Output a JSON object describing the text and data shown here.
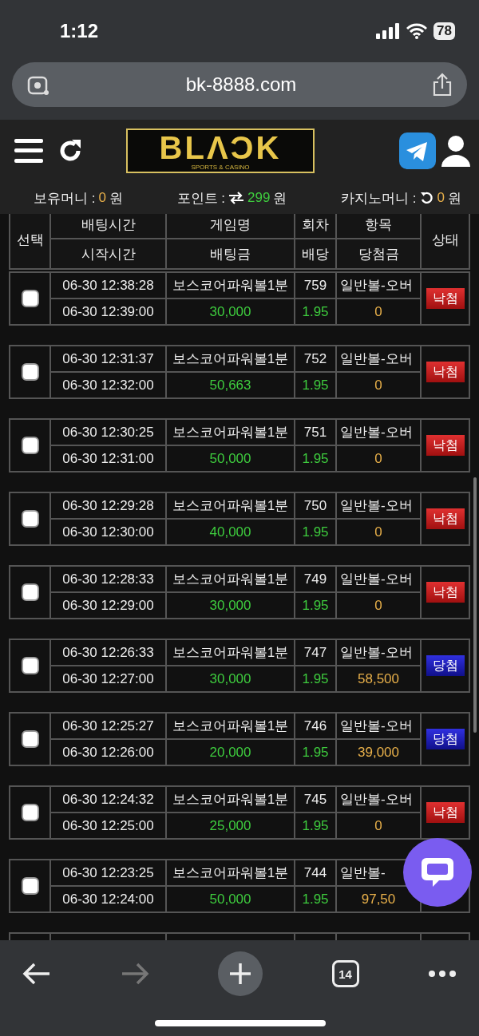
{
  "status_bar": {
    "time": "1:12",
    "battery": "78"
  },
  "browser": {
    "url": "bk-8888.com"
  },
  "header": {
    "logo": "BLΛƆK",
    "logo_tagline": "SPORTS & CASINO"
  },
  "balances": [
    {
      "label": "보유머니 :",
      "value": "0",
      "unit": "원",
      "kind": "plain"
    },
    {
      "label": "포인트 :",
      "value": "299",
      "unit": "원",
      "kind": "point"
    },
    {
      "label": "카지노머니 :",
      "value": "0",
      "unit": "원",
      "kind": "casino"
    }
  ],
  "table": {
    "columns_top": [
      "선택",
      "배팅시간",
      "게임명",
      "회차",
      "항목",
      "상태"
    ],
    "columns_bottom": [
      "시작시간",
      "배팅금",
      "배당",
      "당첨금"
    ],
    "rows": [
      {
        "checked": false,
        "bet_time": "06-30 12:38:28",
        "game": "보스코어파워볼1분",
        "round": "759",
        "item": "일반볼-오버",
        "start_time": "06-30 12:39:00",
        "amount": "30,000",
        "odds": "1.95",
        "winnings": "0",
        "status": {
          "label": "낙첨",
          "kind": "lose"
        }
      },
      {
        "checked": false,
        "bet_time": "06-30 12:31:37",
        "game": "보스코어파워볼1분",
        "round": "752",
        "item": "일반볼-오버",
        "start_time": "06-30 12:32:00",
        "amount": "50,663",
        "odds": "1.95",
        "winnings": "0",
        "status": {
          "label": "낙첨",
          "kind": "lose"
        }
      },
      {
        "checked": false,
        "bet_time": "06-30 12:30:25",
        "game": "보스코어파워볼1분",
        "round": "751",
        "item": "일반볼-오버",
        "start_time": "06-30 12:31:00",
        "amount": "50,000",
        "odds": "1.95",
        "winnings": "0",
        "status": {
          "label": "낙첨",
          "kind": "lose"
        }
      },
      {
        "checked": false,
        "bet_time": "06-30 12:29:28",
        "game": "보스코어파워볼1분",
        "round": "750",
        "item": "일반볼-오버",
        "start_time": "06-30 12:30:00",
        "amount": "40,000",
        "odds": "1.95",
        "winnings": "0",
        "status": {
          "label": "낙첨",
          "kind": "lose"
        }
      },
      {
        "checked": false,
        "bet_time": "06-30 12:28:33",
        "game": "보스코어파워볼1분",
        "round": "749",
        "item": "일반볼-오버",
        "start_time": "06-30 12:29:00",
        "amount": "30,000",
        "odds": "1.95",
        "winnings": "0",
        "status": {
          "label": "낙첨",
          "kind": "lose"
        }
      },
      {
        "checked": false,
        "bet_time": "06-30 12:26:33",
        "game": "보스코어파워볼1분",
        "round": "747",
        "item": "일반볼-오버",
        "start_time": "06-30 12:27:00",
        "amount": "30,000",
        "odds": "1.95",
        "winnings": "58,500",
        "status": {
          "label": "당첨",
          "kind": "win"
        }
      },
      {
        "checked": false,
        "bet_time": "06-30 12:25:27",
        "game": "보스코어파워볼1분",
        "round": "746",
        "item": "일반볼-오버",
        "start_time": "06-30 12:26:00",
        "amount": "20,000",
        "odds": "1.95",
        "winnings": "39,000",
        "status": {
          "label": "당첨",
          "kind": "win"
        }
      },
      {
        "checked": false,
        "bet_time": "06-30 12:24:32",
        "game": "보스코어파워볼1분",
        "round": "745",
        "item": "일반볼-오버",
        "start_time": "06-30 12:25:00",
        "amount": "25,000",
        "odds": "1.95",
        "winnings": "0",
        "status": {
          "label": "낙첨",
          "kind": "lose"
        }
      },
      {
        "checked": false,
        "bet_time": "06-30 12:23:25",
        "game": "보스코어파워볼1분",
        "round": "744",
        "item": "일반볼-",
        "start_time": "06-30 12:24:00",
        "amount": "50,000",
        "odds": "1.95",
        "winnings": "97,50"
      }
    ]
  },
  "toolbar": {
    "forward_disabled": true,
    "tab_count": "14"
  }
}
